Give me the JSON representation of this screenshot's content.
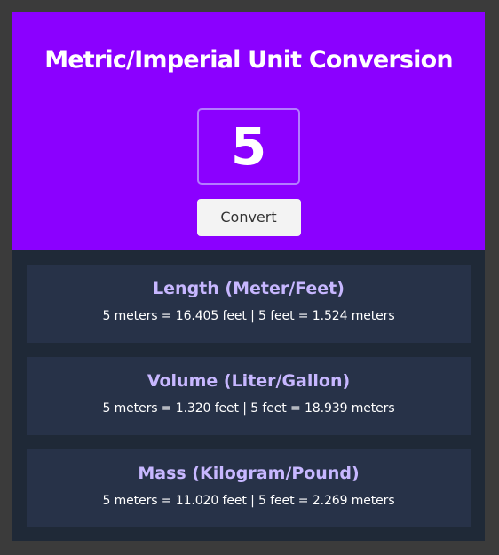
{
  "header": {
    "title": "Metric/Imperial Unit Conversion"
  },
  "input": {
    "value": "5"
  },
  "actions": {
    "convert_label": "Convert"
  },
  "results": [
    {
      "title": "Length (Meter/Feet)",
      "text": "5 meters = 16.405 feet | 5 feet = 1.524 meters"
    },
    {
      "title": "Volume (Liter/Gallon)",
      "text": "5 meters = 1.320 feet | 5 feet = 18.939 meters"
    },
    {
      "title": "Mass (Kilogram/Pound)",
      "text": "5 meters = 11.020 feet | 5 feet = 2.269 meters"
    }
  ],
  "colors": {
    "page_background": "#3b3b3b",
    "hero_background": "#8b00ff",
    "results_background": "#1f2937",
    "card_background": "#273248",
    "card_title": "#c7b7ff",
    "button_background": "#f3f3f3"
  }
}
